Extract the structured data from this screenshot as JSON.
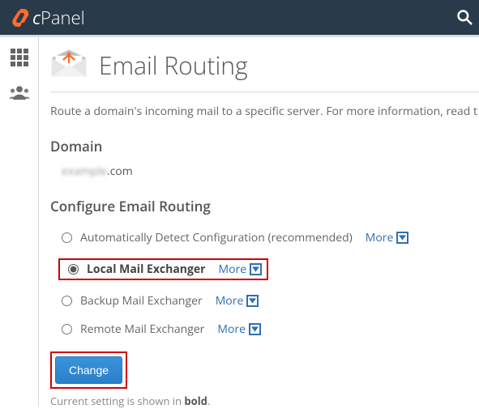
{
  "brand": {
    "name": "cPanel"
  },
  "page": {
    "title": "Email Routing",
    "intro": "Route a domain's incoming mail to a specific server. For more information, read t"
  },
  "domain": {
    "heading": "Domain",
    "value_blurred": "example",
    "value_suffix": ".com"
  },
  "routing": {
    "heading": "Configure Email Routing",
    "more_label": "More",
    "options": [
      {
        "id": "auto",
        "label": "Automatically Detect Configuration (recommended)",
        "selected": false,
        "bold": false
      },
      {
        "id": "local",
        "label": "Local Mail Exchanger",
        "selected": true,
        "bold": true
      },
      {
        "id": "backup",
        "label": "Backup Mail Exchanger",
        "selected": false,
        "bold": false
      },
      {
        "id": "remote",
        "label": "Remote Mail Exchanger",
        "selected": false,
        "bold": false
      }
    ]
  },
  "actions": {
    "change": "Change"
  },
  "footnote": {
    "prefix": "Current setting is shown in ",
    "bold": "bold",
    "suffix": "."
  }
}
